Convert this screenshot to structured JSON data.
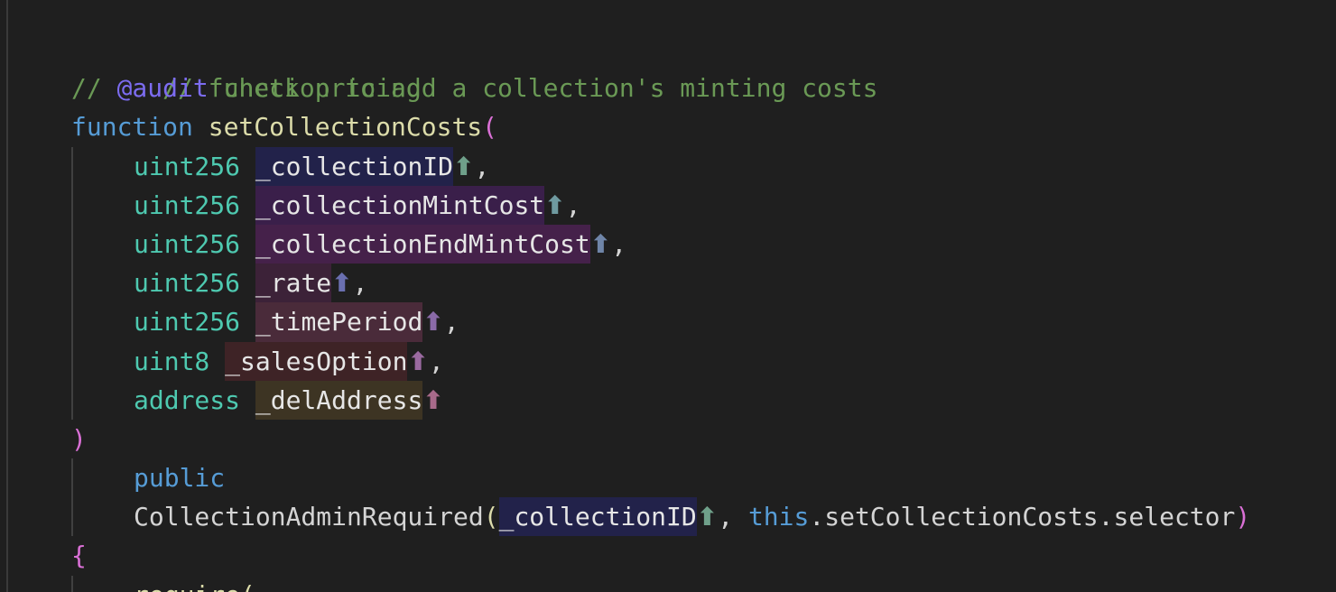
{
  "code": {
    "comment_line1": "// function to add a collection's minting costs",
    "comment_line2_prefix": "// ",
    "comment_line2_tag": "@audit",
    "comment_line2_rest": " check pricing",
    "function_keyword": "function",
    "function_name": "setCollectionCosts",
    "open_paren": "(",
    "close_paren": ")",
    "params": [
      {
        "type": "uint256",
        "name": "_collectionID",
        "suffix": ","
      },
      {
        "type": "uint256",
        "name": "_collectionMintCost",
        "suffix": ","
      },
      {
        "type": "uint256",
        "name": "_collectionEndMintCost",
        "suffix": ","
      },
      {
        "type": "uint256",
        "name": "_rate",
        "suffix": ","
      },
      {
        "type": "uint256",
        "name": "_timePeriod",
        "suffix": ","
      },
      {
        "type": "uint8",
        "name": "_salesOption",
        "suffix": ","
      },
      {
        "type": "address",
        "name": "_delAddress",
        "suffix": ""
      }
    ],
    "arrow_glyph": "⬆",
    "visibility": "public",
    "modifier_name": "CollectionAdminRequired",
    "modifier_arg1": "_collectionID",
    "modifier_sep": ", ",
    "this_keyword": "this",
    "selector_expr": ".setCollectionCosts.selector",
    "open_brace": "{",
    "partial_next_line": "require("
  },
  "colors": {
    "background": "#1f1f1f",
    "comment": "#6a9955",
    "keyword": "#569cd6",
    "function_name": "#dcdcaa",
    "type": "#4ec9b0",
    "bracket": "#da70d6"
  }
}
